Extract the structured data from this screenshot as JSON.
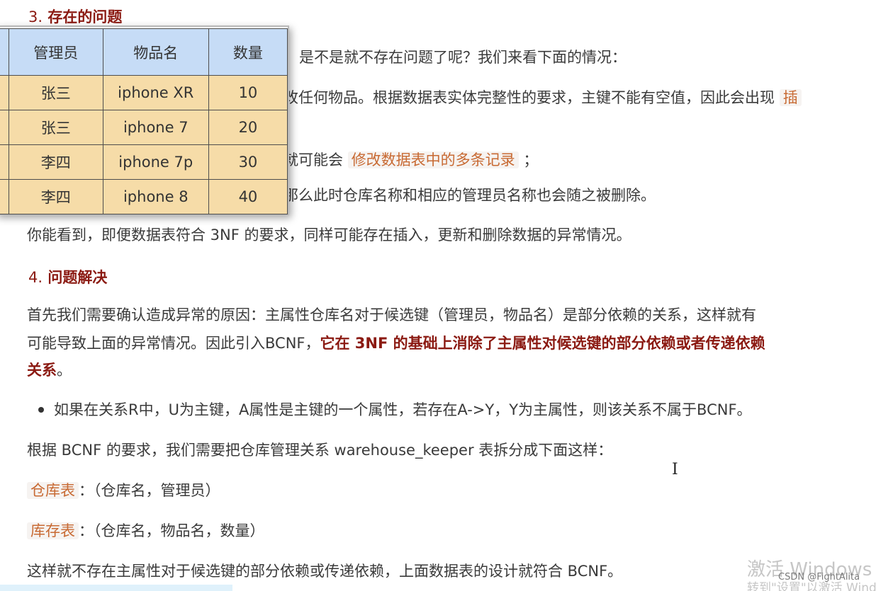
{
  "section3": {
    "number": "3.",
    "title": "存在的问题"
  },
  "table": {
    "headers": [
      "",
      "管理员",
      "物品名",
      "数量"
    ],
    "rows": [
      [
        "",
        "张三",
        "iphone XR",
        "10"
      ],
      [
        "",
        "张三",
        "iphone 7",
        "20"
      ],
      [
        "",
        "李四",
        "iphone 7p",
        "30"
      ],
      [
        "",
        "李四",
        "iphone 8",
        "40"
      ]
    ]
  },
  "partial_lines": {
    "line1": "是不是就不存在问题了呢？我们来看下面的情况：",
    "line2": "改任何物品。根据数据表实体完整性的要求，主键不能有空值，因此会出现",
    "line2_code": "插",
    "line3_prefix": "就可能会",
    "line3_code": "修改数据表中的多条记录",
    "line3_suffix": "；",
    "line4": "那么此时仓库名称和相应的管理员名称也会随之被删除。"
  },
  "para_3nf": "你能看到，即便数据表符合 3NF 的要求，同样可能存在插入，更新和删除数据的异常情况。",
  "section4": {
    "number": "4.",
    "title": "问题解决"
  },
  "para_cause": {
    "line1": "首先我们需要确认造成异常的原因：主属性仓库名对于候选键（管理员，物品名）是部分依赖的关系，这样就有",
    "line2_plain": "可能导致上面的异常情况。因此引入BCNF，",
    "line2_bold": "它在 3NF 的基础上消除了主属性对候选键的部分依赖或者传递依赖",
    "line3_bold": "关系",
    "line3_plain": "。"
  },
  "bullet": "如果在关系R中，U为主键，A属性是主键的一个属性，若存在A->Y，Y为主属性，则该关系不属于BCNF。",
  "para_split": "根据 BCNF 的要求，我们需要把仓库管理关系 warehouse_keeper 表拆分成下面这样：",
  "table_warehouse": {
    "name": "仓库表",
    "fields": "：（仓库名，管理员）"
  },
  "table_inventory": {
    "name": "库存表",
    "fields": "：（仓库名，物品名，数量）"
  },
  "para_final": "这样就不存在主属性对于候选键的部分依赖或传递依赖，上面数据表的设计就符合 BCNF。",
  "watermark": {
    "line1": "激活 Windows",
    "line2": "转到\"设置\"以激活 Windo",
    "csdn": "CSDN @FightAlita"
  },
  "cursor_glyph": "I",
  "colors": {
    "heading": "#8b1a12",
    "code_text": "#c86a33",
    "table_header": "#c6dcf6",
    "table_cell": "#f6dca8"
  }
}
